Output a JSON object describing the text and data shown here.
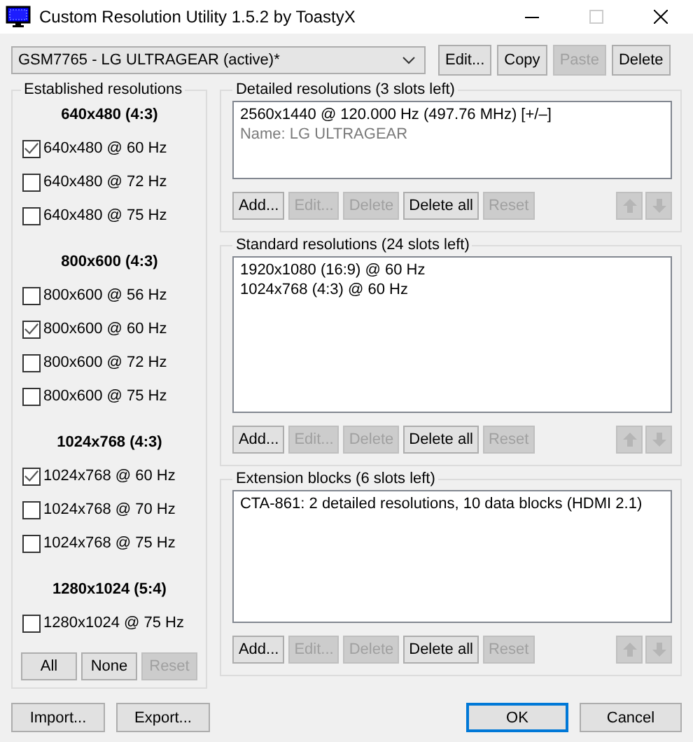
{
  "window": {
    "title": "Custom Resolution Utility 1.5.2 by ToastyX",
    "maximize_disabled": true
  },
  "device_select": {
    "value": "GSM7765 - LG ULTRAGEAR (active)*"
  },
  "toolbar_buttons": [
    {
      "label": "Edit...",
      "disabled": false
    },
    {
      "label": "Copy",
      "disabled": false
    },
    {
      "label": "Paste",
      "disabled": true
    },
    {
      "label": "Delete",
      "disabled": false
    }
  ],
  "established": {
    "title": "Established resolutions",
    "groups": [
      {
        "heading": "640x480 (4:3)",
        "options": [
          {
            "label": "640x480 @ 60 Hz",
            "checked": true
          },
          {
            "label": "640x480 @ 72 Hz",
            "checked": false
          },
          {
            "label": "640x480 @ 75 Hz",
            "checked": false
          }
        ]
      },
      {
        "heading": "800x600 (4:3)",
        "options": [
          {
            "label": "800x600 @ 56 Hz",
            "checked": false
          },
          {
            "label": "800x600 @ 60 Hz",
            "checked": true
          },
          {
            "label": "800x600 @ 72 Hz",
            "checked": false
          },
          {
            "label": "800x600 @ 75 Hz",
            "checked": false
          }
        ]
      },
      {
        "heading": "1024x768 (4:3)",
        "options": [
          {
            "label": "1024x768 @ 60 Hz",
            "checked": true
          },
          {
            "label": "1024x768 @ 70 Hz",
            "checked": false
          },
          {
            "label": "1024x768 @ 75 Hz",
            "checked": false
          }
        ]
      },
      {
        "heading": "1280x1024 (5:4)",
        "options": [
          {
            "label": "1280x1024 @ 75 Hz",
            "checked": false
          }
        ]
      }
    ],
    "buttons": [
      {
        "label": "All",
        "disabled": false
      },
      {
        "label": "None",
        "disabled": false
      },
      {
        "label": "Reset",
        "disabled": true
      }
    ]
  },
  "sections": [
    {
      "title": "Detailed resolutions (3 slots left)",
      "lines": [
        {
          "text": "2560x1440 @ 120.000 Hz (497.76 MHz) [+/–]",
          "kind": "entry"
        },
        {
          "text": "Name: LG ULTRAGEAR",
          "kind": "note"
        }
      ],
      "buttons": [
        {
          "label": "Add...",
          "disabled": false
        },
        {
          "label": "Edit...",
          "disabled": true
        },
        {
          "label": "Delete",
          "disabled": true
        },
        {
          "label": "Delete all",
          "disabled": false
        },
        {
          "label": "Reset",
          "disabled": true
        }
      ],
      "arrows": [
        {
          "kind": "up",
          "disabled": true
        },
        {
          "kind": "down",
          "disabled": true
        }
      ]
    },
    {
      "title": "Standard resolutions (24 slots left)",
      "lines": [
        {
          "text": "1920x1080 (16:9) @ 60 Hz",
          "kind": "entry"
        },
        {
          "text": "1024x768 (4:3) @ 60 Hz",
          "kind": "entry"
        }
      ],
      "buttons": [
        {
          "label": "Add...",
          "disabled": false
        },
        {
          "label": "Edit...",
          "disabled": true
        },
        {
          "label": "Delete",
          "disabled": true
        },
        {
          "label": "Delete all",
          "disabled": false
        },
        {
          "label": "Reset",
          "disabled": true
        }
      ],
      "arrows": [
        {
          "kind": "up",
          "disabled": true
        },
        {
          "kind": "down",
          "disabled": true
        }
      ]
    },
    {
      "title": "Extension blocks (6 slots left)",
      "lines": [
        {
          "text": "CTA-861: 2 detailed resolutions, 10 data blocks (HDMI 2.1)",
          "kind": "entry"
        }
      ],
      "buttons": [
        {
          "label": "Add...",
          "disabled": false
        },
        {
          "label": "Edit...",
          "disabled": true
        },
        {
          "label": "Delete",
          "disabled": true
        },
        {
          "label": "Delete all",
          "disabled": false
        },
        {
          "label": "Reset",
          "disabled": true
        }
      ],
      "arrows": [
        {
          "kind": "up",
          "disabled": true
        },
        {
          "kind": "down",
          "disabled": true
        }
      ]
    }
  ],
  "footer_left": [
    {
      "label": "Import...",
      "default": false
    },
    {
      "label": "Export...",
      "default": false
    }
  ],
  "footer_right": [
    {
      "label": "OK",
      "default": true
    },
    {
      "label": "Cancel",
      "default": false
    }
  ]
}
